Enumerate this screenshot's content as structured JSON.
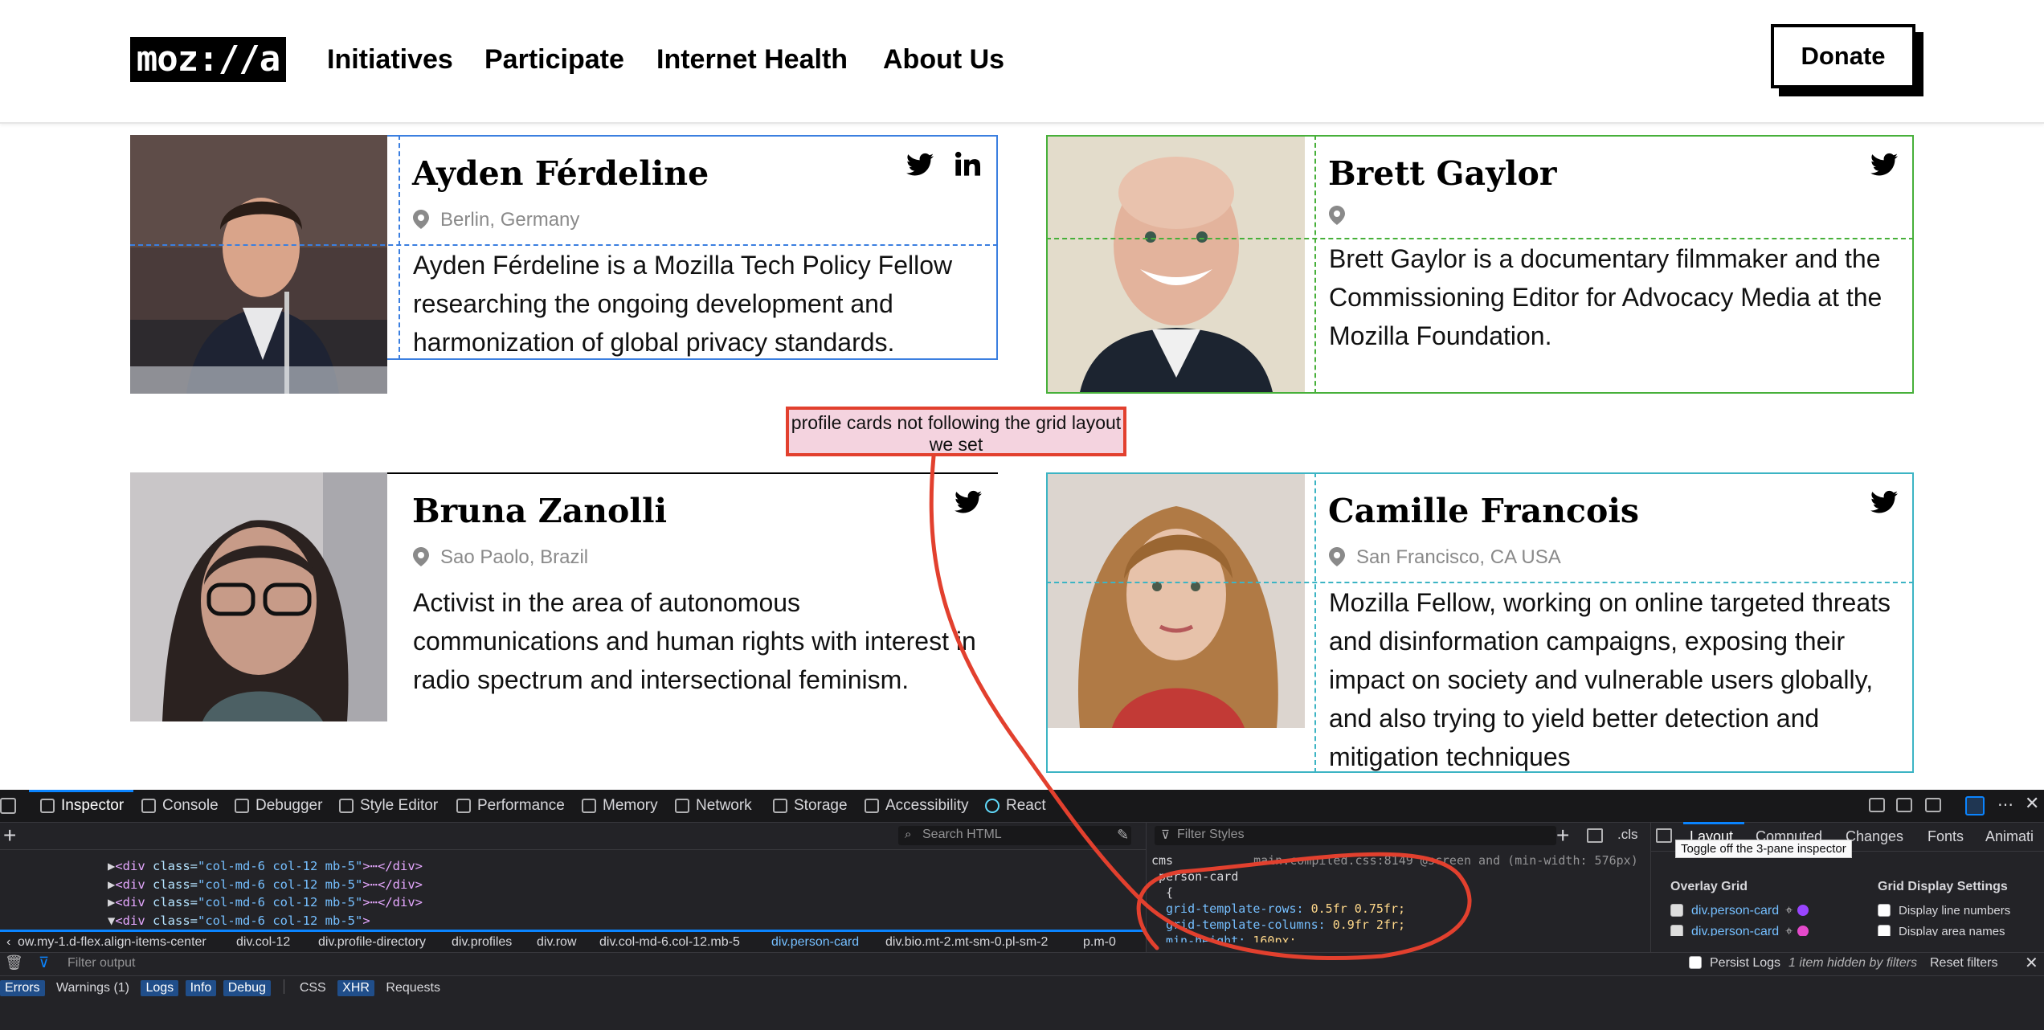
{
  "nav": {
    "logo": "moz://a",
    "links": [
      "Initiatives",
      "Participate",
      "Internet Health",
      "About Us"
    ],
    "donate_label": "Donate"
  },
  "cards": [
    {
      "name": "Ayden Férdeline",
      "location": "Berlin, Germany",
      "bio": "Ayden Férdeline is a Mozilla Tech Policy Fellow researching the ongoing development and harmonization of global privacy standards.",
      "social": [
        "twitter-icon",
        "linkedin-icon"
      ],
      "outline_color": "#3b7fe0"
    },
    {
      "name": "Brett Gaylor",
      "location": "",
      "bio": "Brett Gaylor is a documentary filmmaker and the Commissioning Editor for Advocacy Media at the Mozilla Foundation.",
      "social": [
        "twitter-icon"
      ],
      "outline_color": "#47b03a"
    },
    {
      "name": "Bruna Zanolli",
      "location": "Sao Paolo, Brazil",
      "bio": "Activist in the area of autonomous communications and human rights with interest in radio spectrum and intersectional feminism.",
      "social": [
        "twitter-icon"
      ],
      "outline_color": "#000000"
    },
    {
      "name": "Camille Francois",
      "location": "San Francisco, CA USA",
      "bio": "Mozilla Fellow, working on online targeted threats and disinformation campaigns, exposing their impact on society and vulnerable users globally, and also trying to yield better detection and mitigation techniques",
      "social": [
        "twitter-icon"
      ],
      "outline_color": "#3cb4c4"
    }
  ],
  "annotation": {
    "text": "profile cards not following the grid layout we set",
    "color": "#e2402e"
  },
  "devtools": {
    "tabs": [
      "Inspector",
      "Console",
      "Debugger",
      "Style Editor",
      "Performance",
      "Memory",
      "Network",
      "Storage",
      "Accessibility",
      "React"
    ],
    "search_html_placeholder": "Search HTML",
    "filter_styles_placeholder": "Filter Styles",
    "cls_label": ".cls",
    "html_lines": [
      {
        "prefix": "▶",
        "tag_open": "<div ",
        "attr": "class=",
        "val": "\"col-md-6 col-12 mb-5\"",
        "rest": ">⋯</div>"
      },
      {
        "prefix": "▶",
        "tag_open": "<div ",
        "attr": "class=",
        "val": "\"col-md-6 col-12 mb-5\"",
        "rest": ">⋯</div>"
      },
      {
        "prefix": "▶",
        "tag_open": "<div ",
        "attr": "class=",
        "val": "\"col-md-6 col-12 mb-5\"",
        "rest": ">⋯</div>"
      },
      {
        "prefix": "▼",
        "tag_open": "<div ",
        "attr": "class=",
        "val": "\"col-md-6 col-12 mb-5\"",
        "rest": ">"
      }
    ],
    "breadcrumbs": [
      "ow.my-1.d-flex.align-items-center",
      "div.col-12",
      "div.profile-directory",
      "div.profiles",
      "div.row",
      "div.col-md-6.col-12.mb-5",
      "div.person-card",
      "div.bio.mt-2.mt-sm-0.pl-sm-2",
      "p.m-0"
    ],
    "rule_media": "cms",
    "rule_source": "main.compiled.css:8149 @screen and (min-width: 576px)",
    "rule_selector": ".person-card",
    "rule_brace": "{",
    "rule_props": [
      {
        "prop": "grid-template-rows:",
        "value": "0.5fr 0.75fr;"
      },
      {
        "prop": "grid-template-columns:",
        "value": "0.9fr 2fr;"
      },
      {
        "prop": "min-height:",
        "value": "160px;"
      }
    ],
    "layout_tabs": [
      "Layout",
      "Computed",
      "Changes",
      "Fonts",
      "Animati"
    ],
    "tooltip": "Toggle off the 3-pane inspector",
    "overlay_grid_title": "Overlay Grid",
    "grid_display_title": "Grid Display Settings",
    "overlay_items": [
      "div.person-card",
      "div.person-card"
    ],
    "display_options": [
      "Display line numbers",
      "Display area names"
    ],
    "filter_output_placeholder": "Filter output",
    "persist_logs": "Persist Logs",
    "hidden_note": "1 item hidden by filters",
    "reset_filters": "Reset filters",
    "console_filters": [
      "Errors",
      "Warnings (1)",
      "Logs",
      "Info",
      "Debug",
      "CSS",
      "XHR",
      "Requests"
    ]
  }
}
